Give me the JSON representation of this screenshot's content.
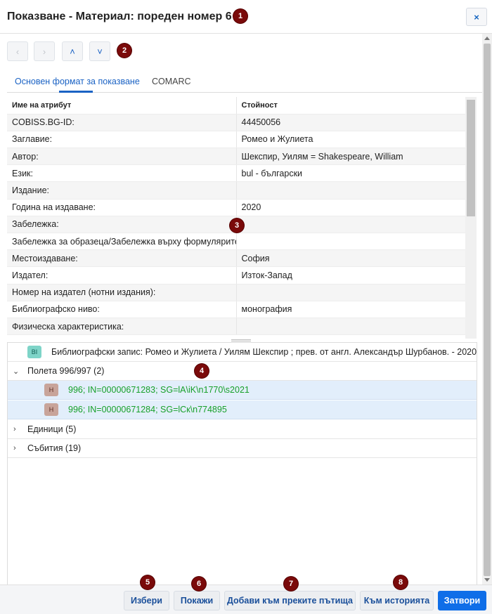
{
  "dialog": {
    "title": "Показване - Материал: пореден номер 6",
    "close_icon": "×"
  },
  "markers": [
    "1",
    "2",
    "3",
    "4",
    "5",
    "6",
    "7",
    "8"
  ],
  "nav": {
    "prev_icon": "‹",
    "next_icon": "›",
    "up_icon": "˄",
    "down_icon": "˅"
  },
  "tabs": [
    {
      "label": "Основен формат за показване",
      "active": true
    },
    {
      "label": "COMARC",
      "active": false
    }
  ],
  "attr_table": {
    "headers": [
      "Име на атрибут",
      "Стойност"
    ],
    "rows": [
      [
        "COBISS.BG-ID:",
        "44450056"
      ],
      [
        "Заглавие:",
        "Ромео и Жулиета"
      ],
      [
        "Автор:",
        "Шекспир, Уилям = Shakespeare, William"
      ],
      [
        "Език:",
        "bul - български"
      ],
      [
        "Издание:",
        ""
      ],
      [
        "Година на издаване:",
        "2020"
      ],
      [
        "Забележка:",
        ""
      ],
      [
        "Забележка за образеца/Забележка върху формулярите:",
        ""
      ],
      [
        "Местоиздаване:",
        "София"
      ],
      [
        "Издател:",
        "Изток-Запад"
      ],
      [
        "Номер на издател (нотни издания):",
        ""
      ],
      [
        "Библиографско ниво:",
        "монография"
      ],
      [
        "Физическа характеристика:",
        ""
      ]
    ]
  },
  "tree": {
    "record": {
      "badge": "BI",
      "text": "Библиографски запис: Ромео и Жулиета / Уилям Шекспир ; прев. от англ. Александър Шурбанов. - 2020"
    },
    "fields_group": {
      "label": "Полета 996/997 (2)",
      "expanded": true
    },
    "fields": [
      {
        "badge": "H",
        "text": "996; IN=00000671283; SG=lA\\iK\\n1770\\s2021"
      },
      {
        "badge": "H",
        "text": "996; IN=00000671284; SG=lCк\\n774895"
      }
    ],
    "units": {
      "label": "Единици (5)"
    },
    "events": {
      "label": "Събития (19)"
    }
  },
  "footer": {
    "select_label": "Избери",
    "show_label": "Покажи",
    "add_shortcuts_label": "Добави към преките пътища",
    "history_label": "Към историята",
    "close_label": "Затвори"
  },
  "colors": {
    "accent": "#0f6ee8",
    "marker": "#7a0a0a",
    "field_text": "#18a02a",
    "selected_row": "#e2eefb"
  }
}
